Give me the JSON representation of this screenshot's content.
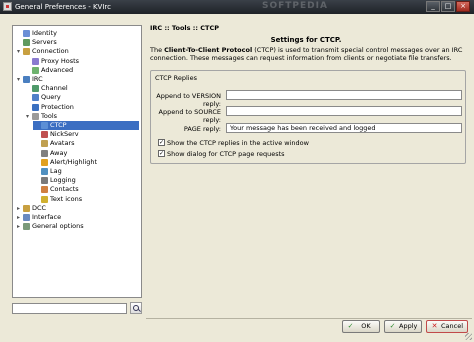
{
  "window": {
    "title": "General Preferences - KVIrc",
    "watermark": "SOFTPEDIA",
    "controls": {
      "minimize": "_",
      "maximize": "□",
      "close": "×"
    }
  },
  "tree": {
    "items": [
      {
        "label": "Identity",
        "level": 1,
        "expander": "",
        "icon_color": "#6b8fd6"
      },
      {
        "label": "Servers",
        "level": 1,
        "expander": "",
        "icon_color": "#5f9a5f"
      },
      {
        "label": "Connection",
        "level": 1,
        "expander": "▾",
        "icon_color": "#c8a040"
      },
      {
        "label": "Proxy Hosts",
        "level": 2,
        "expander": "",
        "icon_color": "#8a7bd0"
      },
      {
        "label": "Advanced",
        "level": 2,
        "expander": "",
        "icon_color": "#6fb36f"
      },
      {
        "label": "IRC",
        "level": 1,
        "expander": "▾",
        "icon_color": "#4a7fc0"
      },
      {
        "label": "Channel",
        "level": 2,
        "expander": "",
        "icon_color": "#4f9a6a"
      },
      {
        "label": "Query",
        "level": 2,
        "expander": "",
        "icon_color": "#4f80c8"
      },
      {
        "label": "Protection",
        "level": 2,
        "expander": "",
        "icon_color": "#3a70c0"
      },
      {
        "label": "Tools",
        "level": 2,
        "expander": "▾",
        "icon_color": "#9a9a9a"
      },
      {
        "label": "CTCP",
        "level": 3,
        "expander": "",
        "icon_color": "#5c8fd6",
        "selected": true
      },
      {
        "label": "NickServ",
        "level": 3,
        "expander": "",
        "icon_color": "#c05050"
      },
      {
        "label": "Avatars",
        "level": 3,
        "expander": "",
        "icon_color": "#c0a050"
      },
      {
        "label": "Away",
        "level": 3,
        "expander": "",
        "icon_color": "#808080"
      },
      {
        "label": "Alert/Highlight",
        "level": 3,
        "expander": "",
        "icon_color": "#e0a020"
      },
      {
        "label": "Lag",
        "level": 3,
        "expander": "",
        "icon_color": "#5090c0"
      },
      {
        "label": "Logging",
        "level": 3,
        "expander": "",
        "icon_color": "#7a7a7a"
      },
      {
        "label": "Contacts",
        "level": 3,
        "expander": "",
        "icon_color": "#d08040"
      },
      {
        "label": "Text icons",
        "level": 3,
        "expander": "",
        "icon_color": "#d0b030"
      },
      {
        "label": "DCC",
        "level": 1,
        "expander": "▸",
        "icon_color": "#c8a040"
      },
      {
        "label": "Interface",
        "level": 1,
        "expander": "▸",
        "icon_color": "#6a8ac0"
      },
      {
        "label": "General options",
        "level": 1,
        "expander": "▸",
        "icon_color": "#7a9a7a"
      }
    ],
    "search_value": ""
  },
  "content": {
    "breadcrumb": "IRC :: Tools :: CTCP",
    "title": "Settings for CTCP.",
    "description_prefix": "The ",
    "description_bold": "Client-To-Client Protocol",
    "description_rest": " (CTCP) is used to transmit special control messages over an IRC connection. These messages can request information from clients or negotiate file transfers.",
    "group_title": "CTCP Replies",
    "fields": {
      "version": {
        "label": "Append to VERSION reply:",
        "value": ""
      },
      "source": {
        "label": "Append to SOURCE reply:",
        "value": ""
      },
      "page": {
        "label": "PAGE reply:",
        "value": "Your message has been received and logged"
      }
    },
    "checkboxes": {
      "show_replies": {
        "label": "Show the CTCP replies in the active window",
        "checked": true,
        "mark": "✓"
      },
      "show_dialog": {
        "label": "Show dialog for CTCP page requests",
        "checked": true,
        "mark": "✓"
      }
    }
  },
  "buttons": {
    "ok": "OK",
    "apply": "Apply",
    "cancel": "Cancel"
  },
  "colors": {
    "selection": "#3b6ec2",
    "ok_icon": "#2e8b2e",
    "cancel_icon": "#cc2222"
  }
}
